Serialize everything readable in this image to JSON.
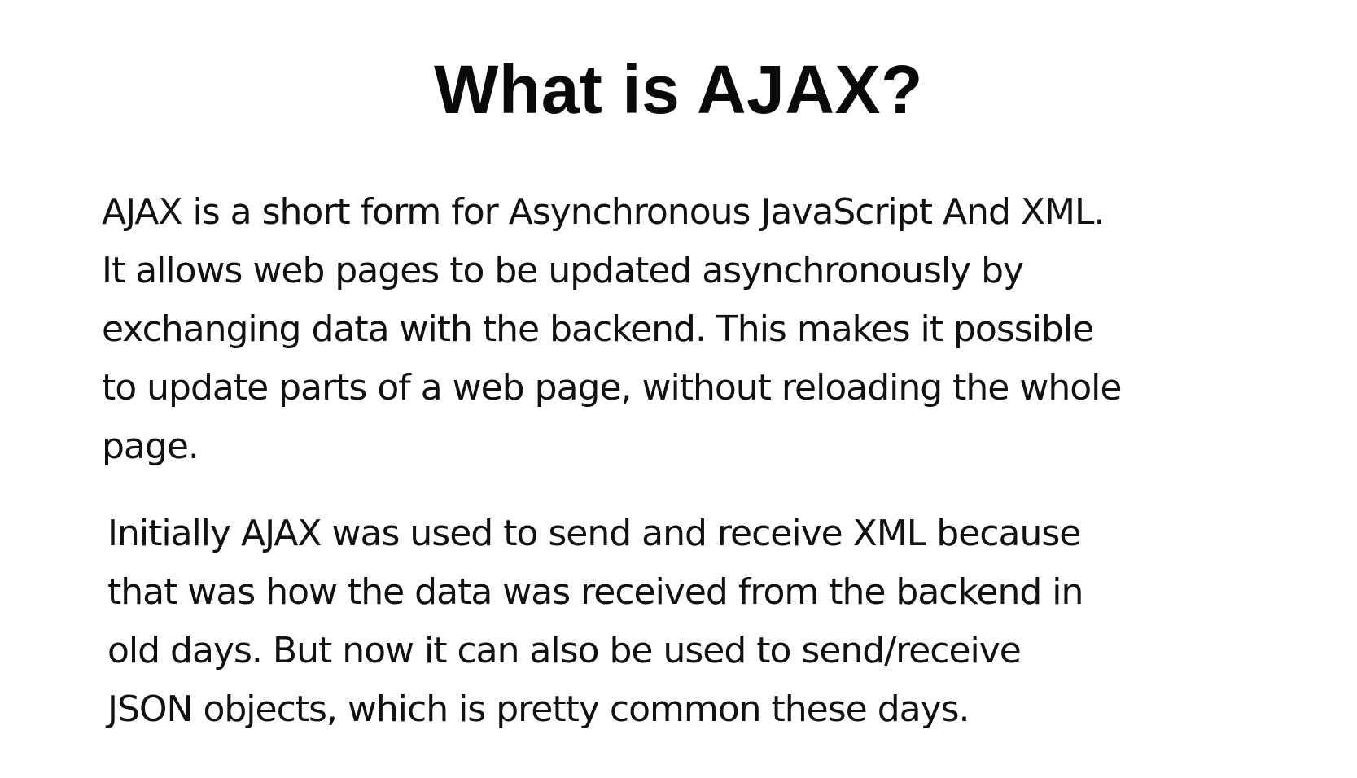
{
  "slide": {
    "title": "What is AJAX?",
    "paragraphs": [
      {
        "lines": [
          "AJAX is a short form for Asynchronous JavaScript And XML.",
          "It allows web pages to be updated asynchronously by",
          "exchanging data with the backend. This makes it possible",
          "to update parts of a web page, without reloading the whole",
          "page."
        ]
      },
      {
        "lines": [
          "Initially AJAX was used to send and receive XML because",
          "that was how the data was received from the backend in",
          "old days. But now it can also be used to send/receive",
          "JSON objects, which is pretty common these days."
        ]
      }
    ]
  }
}
